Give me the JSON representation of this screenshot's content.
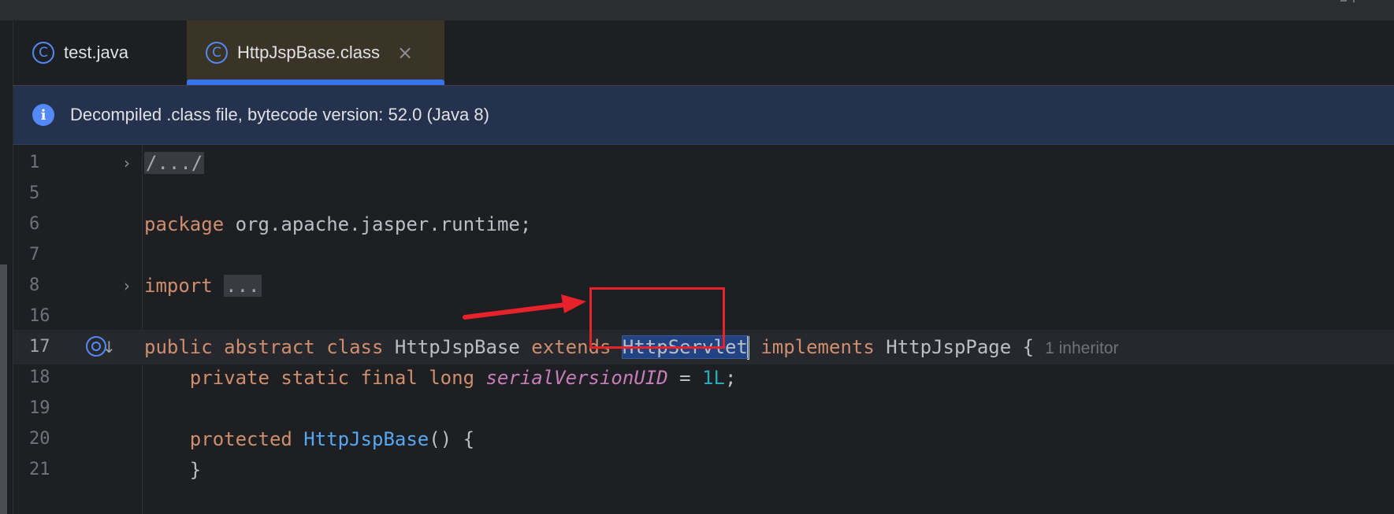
{
  "tabs": [
    {
      "icon": "class-icon",
      "glyph": "C",
      "label": "test.java",
      "active": false
    },
    {
      "icon": "class-icon",
      "glyph": "C",
      "label": "HttpJspBase.class",
      "active": true,
      "close": "×"
    }
  ],
  "notice": {
    "icon": "info-icon",
    "glyph": "i",
    "text": "Decompiled .class file, bytecode version: 52.0 (Java 8)"
  },
  "editor": {
    "line_numbers": [
      "1",
      "5",
      "6",
      "7",
      "8",
      "16",
      "17",
      "18",
      "19",
      "20",
      "21"
    ],
    "fold_marker": "›",
    "l1_folded": "/.../",
    "l6_kw": "package",
    "l6_rest": " org.apache.jasper.runtime;",
    "l8_kw": "import",
    "l8_folded": "...",
    "l17": {
      "kw1": "public abstract class",
      "cls": "HttpJspBase",
      "kw2": "extends",
      "selected": "HttpServlet",
      "kw3": "implements",
      "iface": "HttpJspPage",
      "brace": "{",
      "hint": "1 inheritor"
    },
    "l18": {
      "kw": "private static final long",
      "field": "serialVersionUID",
      "eq": " = ",
      "num": "1L",
      "end": ";"
    },
    "l20": {
      "kw": "protected",
      "method": "HttpJspBase",
      "rest": "() {"
    },
    "l21": "}"
  },
  "colors": {
    "accent": "#3574f0",
    "annotation": "#e8222a",
    "keyword": "#cf8e6d",
    "method": "#56a8f5",
    "field": "#c77dbb",
    "number": "#2aacb8"
  }
}
